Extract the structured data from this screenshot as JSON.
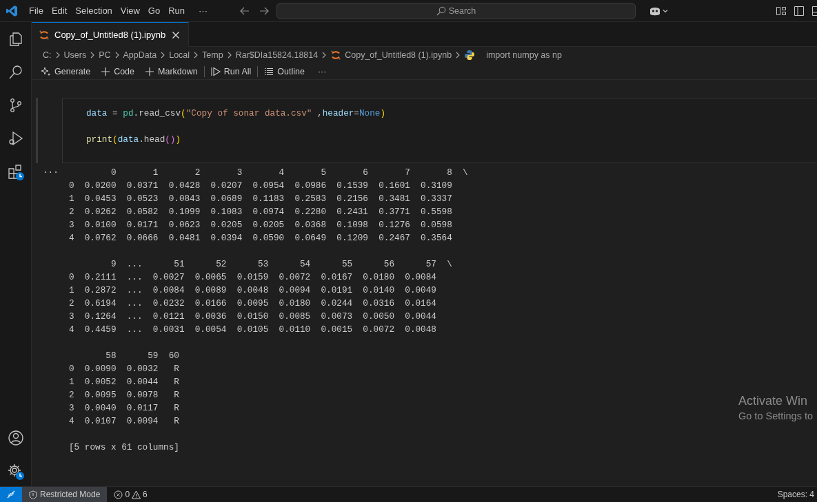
{
  "menu_bar": {
    "items": [
      "File",
      "Edit",
      "Selection",
      "View",
      "Go",
      "Run"
    ],
    "more": "···"
  },
  "command_center": {
    "placeholder": "Search"
  },
  "tabs": [
    {
      "label": "Copy_of_Untitled8 (1).ipynb",
      "selected": true
    }
  ],
  "breadcrumb": [
    {
      "label": "C:",
      "kind": "folder"
    },
    {
      "label": "Users",
      "kind": "folder"
    },
    {
      "label": "PC",
      "kind": "folder"
    },
    {
      "label": "AppData",
      "kind": "folder"
    },
    {
      "label": "Local",
      "kind": "folder"
    },
    {
      "label": "Temp",
      "kind": "folder"
    },
    {
      "label": "Rar$DIa15824.18814",
      "kind": "folder"
    },
    {
      "label": "Copy_of_Untitled8 (1).ipynb",
      "kind": "notebook"
    },
    {
      "label": "import numpy as np",
      "kind": "python"
    }
  ],
  "toolbar": [
    {
      "label": "Generate",
      "kind": "generate"
    },
    {
      "label": "Code",
      "kind": "add"
    },
    {
      "label": "Markdown",
      "kind": "add"
    },
    {
      "label": "Run All",
      "kind": "run"
    },
    {
      "label": "Outline",
      "kind": "outline"
    },
    {
      "label": "···",
      "kind": "more"
    }
  ],
  "cell": {
    "code_lines": [
      [
        {
          "text": "data",
          "kind": "var"
        },
        {
          "text": " = ",
          "kind": "plain"
        },
        {
          "text": "pd",
          "kind": "module"
        },
        {
          "text": ".read_csv",
          "kind": "plain"
        },
        {
          "text": "(",
          "kind": "bracket1"
        },
        {
          "text": "\"Copy of sonar data.csv\"",
          "kind": "string"
        },
        {
          "text": " ,",
          "kind": "plain"
        },
        {
          "text": "header",
          "kind": "var"
        },
        {
          "text": "=",
          "kind": "plain"
        },
        {
          "text": "None",
          "kind": "keyword"
        },
        {
          "text": ")",
          "kind": "bracket1"
        }
      ],
      [
        {
          "text": "print",
          "kind": "function"
        },
        {
          "text": "(",
          "kind": "bracket1"
        },
        {
          "text": "data",
          "kind": "var"
        },
        {
          "text": ".head",
          "kind": "plain"
        },
        {
          "text": "()",
          "kind": "bracket2"
        },
        {
          "text": ")",
          "kind": "bracket1"
        }
      ]
    ],
    "output_more": "···",
    "output_blocks": [
      [
        "        0       1       2       3       4       5       6       7       8  \\",
        "0  0.0200  0.0371  0.0428  0.0207  0.0954  0.0986  0.1539  0.1601  0.3109",
        "1  0.0453  0.0523  0.0843  0.0689  0.1183  0.2583  0.2156  0.3481  0.3337",
        "2  0.0262  0.0582  0.1099  0.1083  0.0974  0.2280  0.2431  0.3771  0.5598",
        "3  0.0100  0.0171  0.0623  0.0205  0.0205  0.0368  0.1098  0.1276  0.0598",
        "4  0.0762  0.0666  0.0481  0.0394  0.0590  0.0649  0.1209  0.2467  0.3564"
      ],
      [
        "        9  ...      51      52      53      54      55      56      57  \\",
        "0  0.2111  ...  0.0027  0.0065  0.0159  0.0072  0.0167  0.0180  0.0084",
        "1  0.2872  ...  0.0084  0.0089  0.0048  0.0094  0.0191  0.0140  0.0049",
        "2  0.6194  ...  0.0232  0.0166  0.0095  0.0180  0.0244  0.0316  0.0164",
        "3  0.1264  ...  0.0121  0.0036  0.0150  0.0085  0.0073  0.0050  0.0044",
        "4  0.4459  ...  0.0031  0.0054  0.0105  0.0110  0.0015  0.0072  0.0048"
      ],
      [
        "       58      59  60",
        "0  0.0090  0.0032   R",
        "1  0.0052  0.0044   R",
        "2  0.0095  0.0078   R",
        "3  0.0040  0.0117   R",
        "4  0.0107  0.0094   R"
      ],
      [
        "[5 rows x 61 columns]"
      ]
    ]
  },
  "status_bar": {
    "restricted_mode": "Restricted Mode",
    "errors": "0",
    "warnings": "6",
    "spaces": "Spaces: 4"
  },
  "activation_notice": {
    "title": "Activate Win",
    "subtitle": "Go to Settings to"
  }
}
